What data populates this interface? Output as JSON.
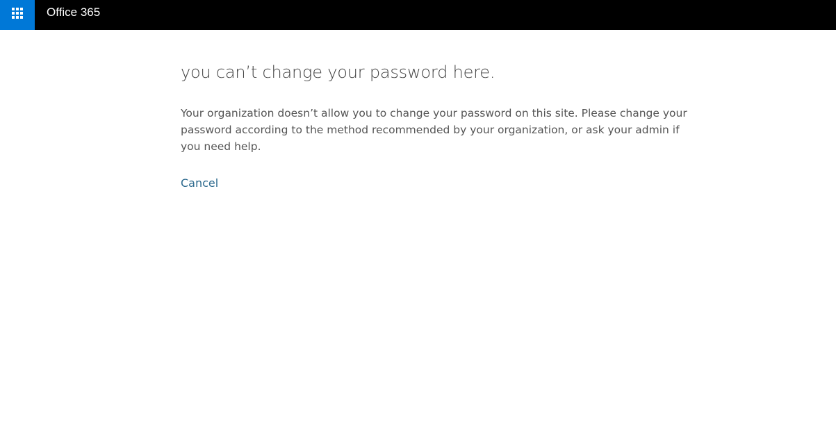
{
  "header": {
    "app_launcher_icon": "waffle-grid-icon",
    "brand": "Office 365",
    "colors": {
      "bar": "#000000",
      "launcher": "#0078d7"
    }
  },
  "main": {
    "title": "you can’t change your password here.",
    "message": "Your organization doesn’t allow you to change your password on this site. Please change your password according to the method recommended by your organization, or ask your admin if you need help.",
    "cancel_label": "Cancel",
    "link_color": "#2f6b8f"
  }
}
